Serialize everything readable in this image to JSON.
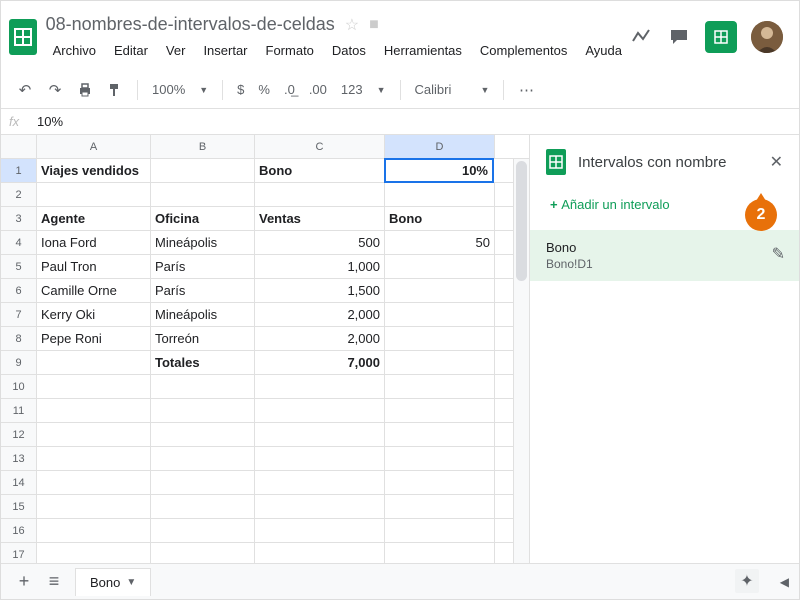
{
  "doc": {
    "title": "08-nombres-de-intervalos-de-celdas"
  },
  "menu": {
    "archivo": "Archivo",
    "editar": "Editar",
    "ver": "Ver",
    "insertar": "Insertar",
    "formato": "Formato",
    "datos": "Datos",
    "herramientas": "Herramientas",
    "complementos": "Complementos",
    "ayuda": "Ayuda"
  },
  "toolbar": {
    "zoom": "100%",
    "currency": "$",
    "percent": "%",
    "dec_less": ".0",
    "dec_more": ".00",
    "numfmt": "123",
    "font": "Calibri"
  },
  "formula": {
    "fx": "fx",
    "value": "10%"
  },
  "cols": {
    "a": "A",
    "b": "B",
    "c": "C",
    "d": "D"
  },
  "col_widths": {
    "a": 114,
    "b": 104,
    "c": 130,
    "d": 110
  },
  "grid": {
    "r1": {
      "a": "Viajes vendidos",
      "c": "Bono",
      "d": "10%"
    },
    "r3": {
      "a": "Agente",
      "b": "Oficina",
      "c": "Ventas",
      "d": "Bono"
    },
    "r4": {
      "a": "Iona Ford",
      "b": "Mineápolis",
      "c": "500",
      "d": "50"
    },
    "r5": {
      "a": "Paul Tron",
      "b": "París",
      "c": "1,000"
    },
    "r6": {
      "a": "Camille Orne",
      "b": "París",
      "c": "1,500"
    },
    "r7": {
      "a": "Kerry Oki",
      "b": "Mineápolis",
      "c": "2,000"
    },
    "r8": {
      "a": "Pepe Roni",
      "b": "Torreón",
      "c": "2,000"
    },
    "r9": {
      "b": "Totales",
      "c": "7,000"
    }
  },
  "panel": {
    "title": "Intervalos con nombre",
    "add": "Añadir un intervalo",
    "range_name": "Bono",
    "range_ref": "Bono!D1"
  },
  "tabs": {
    "sheet1": "Bono"
  },
  "callout": {
    "num": "2"
  }
}
